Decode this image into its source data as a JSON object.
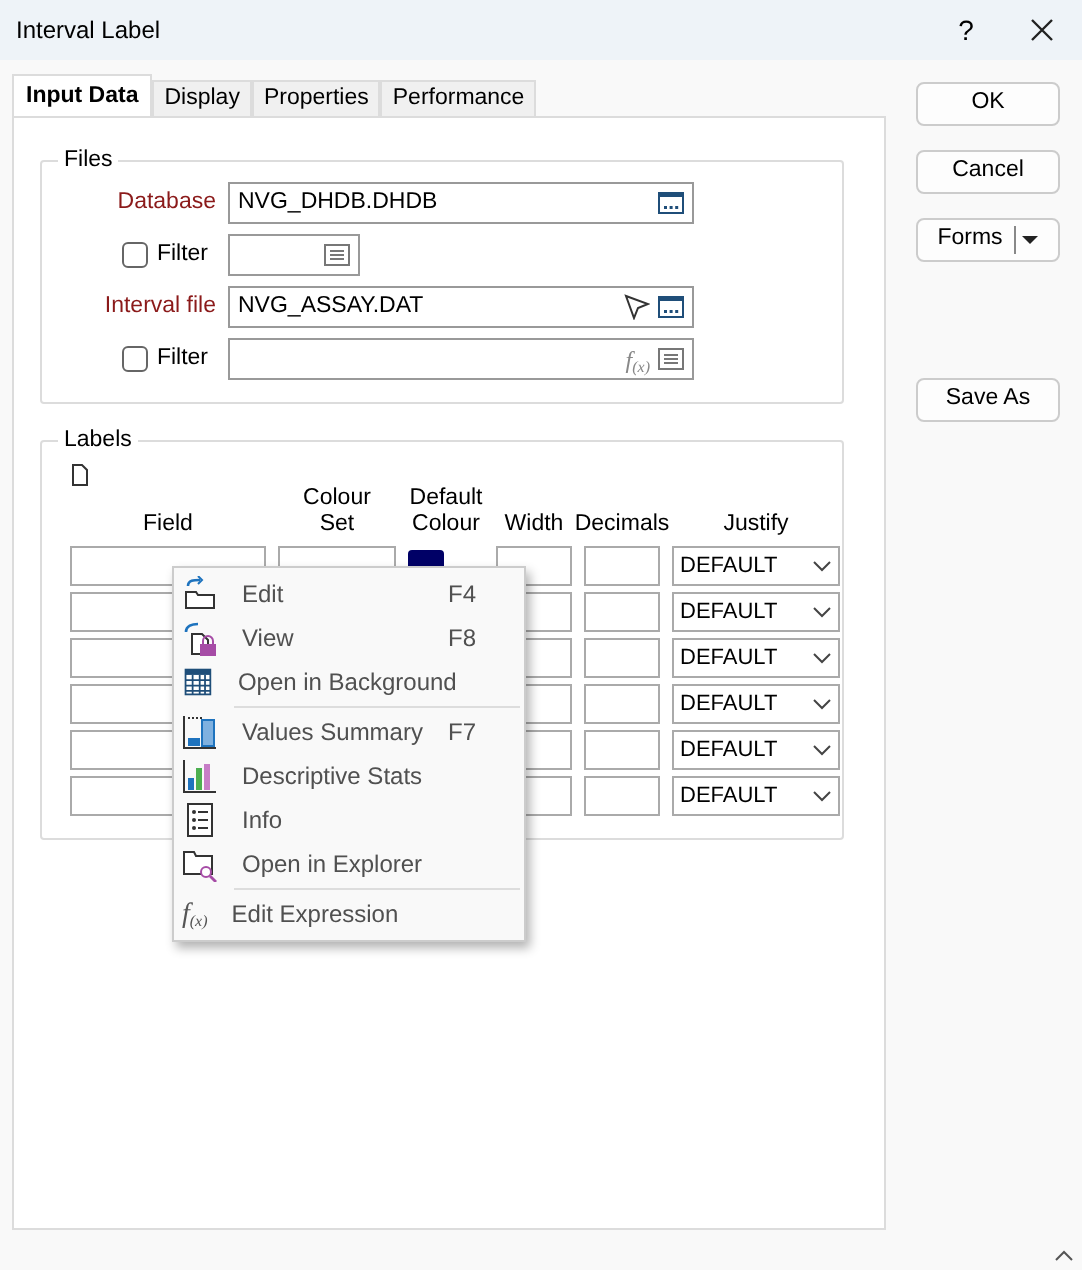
{
  "window": {
    "title": "Interval Label",
    "help": "?"
  },
  "tabs": [
    {
      "label": "Input Data",
      "selected": true
    },
    {
      "label": "Display",
      "selected": false
    },
    {
      "label": "Properties",
      "selected": false
    },
    {
      "label": "Performance",
      "selected": false
    }
  ],
  "files": {
    "title": "Files",
    "rows": [
      {
        "kind": "file",
        "label": "Database",
        "value": "NVG_DHDB.DHDB"
      },
      {
        "kind": "filter",
        "label": "Filter",
        "checked": false,
        "short": true
      },
      {
        "kind": "file",
        "label": "Interval file",
        "value": "NVG_ASSAY.DAT",
        "pick": true
      },
      {
        "kind": "filter",
        "label": "Filter",
        "checked": false,
        "short": false,
        "glyph": "f$_{(x)}$"
      }
    ]
  },
  "labels": {
    "title": "Labels",
    "columns": [
      "Field",
      "Colour Set",
      "Default Colour",
      "Width",
      "Decimals",
      "Justify"
    ],
    "rows": [
      {
        "justify": "DEFAULT",
        "color": "#000066"
      },
      {
        "justify": "DEFAULT"
      },
      {
        "justify": "DEFAULT"
      },
      {
        "justify": "DEFAULT"
      },
      {
        "justify": "DEFAULT"
      },
      {
        "justify": "DEFAULT"
      }
    ]
  },
  "buttons": [
    {
      "label": "OK",
      "kind": "plain"
    },
    {
      "label": "Cancel",
      "kind": "plain"
    },
    {
      "label": "Forms",
      "kind": "split"
    },
    {
      "label": "Save As",
      "kind": "plain"
    }
  ],
  "context_menu": {
    "groups": [
      [
        {
          "label": "Edit",
          "shortcut": "F4"
        },
        {
          "label": "View",
          "shortcut": "F8"
        },
        {
          "label": "Open in Background"
        }
      ],
      [
        {
          "label": "Values Summary",
          "shortcut": "F7"
        },
        {
          "label": "Descriptive Stats"
        },
        {
          "label": "Info"
        },
        {
          "label": "Open in Explorer"
        }
      ],
      [
        {
          "label": "Edit Expression",
          "glyph": "f$_{(x)}$"
        }
      ]
    ]
  }
}
